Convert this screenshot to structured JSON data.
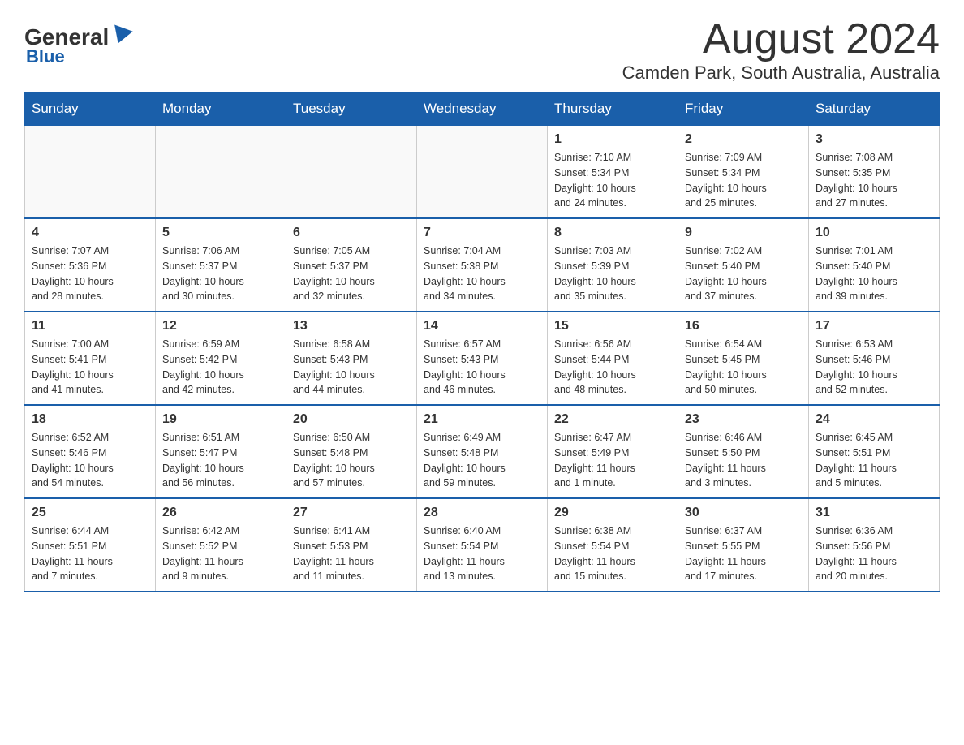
{
  "logo": {
    "general": "General",
    "blue": "Blue"
  },
  "title": {
    "month": "August 2024",
    "location": "Camden Park, South Australia, Australia"
  },
  "weekdays": [
    "Sunday",
    "Monday",
    "Tuesday",
    "Wednesday",
    "Thursday",
    "Friday",
    "Saturday"
  ],
  "weeks": [
    [
      {
        "day": "",
        "info": ""
      },
      {
        "day": "",
        "info": ""
      },
      {
        "day": "",
        "info": ""
      },
      {
        "day": "",
        "info": ""
      },
      {
        "day": "1",
        "info": "Sunrise: 7:10 AM\nSunset: 5:34 PM\nDaylight: 10 hours\nand 24 minutes."
      },
      {
        "day": "2",
        "info": "Sunrise: 7:09 AM\nSunset: 5:34 PM\nDaylight: 10 hours\nand 25 minutes."
      },
      {
        "day": "3",
        "info": "Sunrise: 7:08 AM\nSunset: 5:35 PM\nDaylight: 10 hours\nand 27 minutes."
      }
    ],
    [
      {
        "day": "4",
        "info": "Sunrise: 7:07 AM\nSunset: 5:36 PM\nDaylight: 10 hours\nand 28 minutes."
      },
      {
        "day": "5",
        "info": "Sunrise: 7:06 AM\nSunset: 5:37 PM\nDaylight: 10 hours\nand 30 minutes."
      },
      {
        "day": "6",
        "info": "Sunrise: 7:05 AM\nSunset: 5:37 PM\nDaylight: 10 hours\nand 32 minutes."
      },
      {
        "day": "7",
        "info": "Sunrise: 7:04 AM\nSunset: 5:38 PM\nDaylight: 10 hours\nand 34 minutes."
      },
      {
        "day": "8",
        "info": "Sunrise: 7:03 AM\nSunset: 5:39 PM\nDaylight: 10 hours\nand 35 minutes."
      },
      {
        "day": "9",
        "info": "Sunrise: 7:02 AM\nSunset: 5:40 PM\nDaylight: 10 hours\nand 37 minutes."
      },
      {
        "day": "10",
        "info": "Sunrise: 7:01 AM\nSunset: 5:40 PM\nDaylight: 10 hours\nand 39 minutes."
      }
    ],
    [
      {
        "day": "11",
        "info": "Sunrise: 7:00 AM\nSunset: 5:41 PM\nDaylight: 10 hours\nand 41 minutes."
      },
      {
        "day": "12",
        "info": "Sunrise: 6:59 AM\nSunset: 5:42 PM\nDaylight: 10 hours\nand 42 minutes."
      },
      {
        "day": "13",
        "info": "Sunrise: 6:58 AM\nSunset: 5:43 PM\nDaylight: 10 hours\nand 44 minutes."
      },
      {
        "day": "14",
        "info": "Sunrise: 6:57 AM\nSunset: 5:43 PM\nDaylight: 10 hours\nand 46 minutes."
      },
      {
        "day": "15",
        "info": "Sunrise: 6:56 AM\nSunset: 5:44 PM\nDaylight: 10 hours\nand 48 minutes."
      },
      {
        "day": "16",
        "info": "Sunrise: 6:54 AM\nSunset: 5:45 PM\nDaylight: 10 hours\nand 50 minutes."
      },
      {
        "day": "17",
        "info": "Sunrise: 6:53 AM\nSunset: 5:46 PM\nDaylight: 10 hours\nand 52 minutes."
      }
    ],
    [
      {
        "day": "18",
        "info": "Sunrise: 6:52 AM\nSunset: 5:46 PM\nDaylight: 10 hours\nand 54 minutes."
      },
      {
        "day": "19",
        "info": "Sunrise: 6:51 AM\nSunset: 5:47 PM\nDaylight: 10 hours\nand 56 minutes."
      },
      {
        "day": "20",
        "info": "Sunrise: 6:50 AM\nSunset: 5:48 PM\nDaylight: 10 hours\nand 57 minutes."
      },
      {
        "day": "21",
        "info": "Sunrise: 6:49 AM\nSunset: 5:48 PM\nDaylight: 10 hours\nand 59 minutes."
      },
      {
        "day": "22",
        "info": "Sunrise: 6:47 AM\nSunset: 5:49 PM\nDaylight: 11 hours\nand 1 minute."
      },
      {
        "day": "23",
        "info": "Sunrise: 6:46 AM\nSunset: 5:50 PM\nDaylight: 11 hours\nand 3 minutes."
      },
      {
        "day": "24",
        "info": "Sunrise: 6:45 AM\nSunset: 5:51 PM\nDaylight: 11 hours\nand 5 minutes."
      }
    ],
    [
      {
        "day": "25",
        "info": "Sunrise: 6:44 AM\nSunset: 5:51 PM\nDaylight: 11 hours\nand 7 minutes."
      },
      {
        "day": "26",
        "info": "Sunrise: 6:42 AM\nSunset: 5:52 PM\nDaylight: 11 hours\nand 9 minutes."
      },
      {
        "day": "27",
        "info": "Sunrise: 6:41 AM\nSunset: 5:53 PM\nDaylight: 11 hours\nand 11 minutes."
      },
      {
        "day": "28",
        "info": "Sunrise: 6:40 AM\nSunset: 5:54 PM\nDaylight: 11 hours\nand 13 minutes."
      },
      {
        "day": "29",
        "info": "Sunrise: 6:38 AM\nSunset: 5:54 PM\nDaylight: 11 hours\nand 15 minutes."
      },
      {
        "day": "30",
        "info": "Sunrise: 6:37 AM\nSunset: 5:55 PM\nDaylight: 11 hours\nand 17 minutes."
      },
      {
        "day": "31",
        "info": "Sunrise: 6:36 AM\nSunset: 5:56 PM\nDaylight: 11 hours\nand 20 minutes."
      }
    ]
  ]
}
